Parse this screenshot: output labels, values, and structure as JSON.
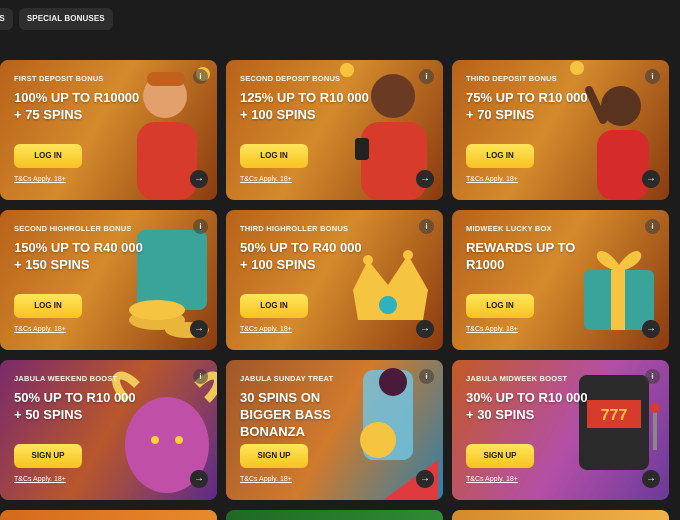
{
  "tabs": [
    {
      "label": "ES"
    },
    {
      "label": "SPECIAL BONUSES"
    }
  ],
  "cards": [
    {
      "label": "FIRST DEPOSIT BONUS",
      "title": "100% UP TO R10000 + 75 SPINS",
      "cta": "LOG IN",
      "terms": "T&Cs Apply. 18+"
    },
    {
      "label": "SECOND DEPOSIT BONUS",
      "title": "125% UP TO R10 000 + 100 SPINS",
      "cta": "LOG IN",
      "terms": "T&Cs Apply. 18+"
    },
    {
      "label": "THIRD DEPOSIT BONUS",
      "title": "75% UP TO R10 000 + 70 SPINS",
      "cta": "LOG IN",
      "terms": "T&Cs Apply. 18+"
    },
    {
      "label": "SECOND HIGHROLLER BONUS",
      "title": "150% UP TO R40 000 + 150 SPINS",
      "cta": "LOG IN",
      "terms": "T&Cs Apply. 18+"
    },
    {
      "label": "THIRD HIGHROLLER BONUS",
      "title": "50% UP TO R40 000 + 100 SPINS",
      "cta": "LOG IN",
      "terms": "T&Cs Apply. 18+"
    },
    {
      "label": "MIDWEEK LUCKY BOX",
      "title": "REWARDS UP TO R1000",
      "cta": "LOG IN",
      "terms": "T&Cs Apply. 18+"
    },
    {
      "label": "JABULA WEEKEND BOOST",
      "title": "50% UP TO R10 000 + 50 SPINS",
      "cta": "SIGN UP",
      "terms": "T&Cs Apply. 18+"
    },
    {
      "label": "JABULA SUNDAY TREAT",
      "title": "30 SPINS ON BIGGER BASS BONANZA",
      "cta": "SIGN UP",
      "terms": "T&Cs Apply. 18+"
    },
    {
      "label": "JABULA MIDWEEK BOOST",
      "title": "30% UP TO R10 000 + 30 SPINS",
      "cta": "SIGN UP",
      "terms": "T&Cs Apply. 18+"
    }
  ],
  "icons": {
    "info": "i",
    "arrow": "→"
  }
}
